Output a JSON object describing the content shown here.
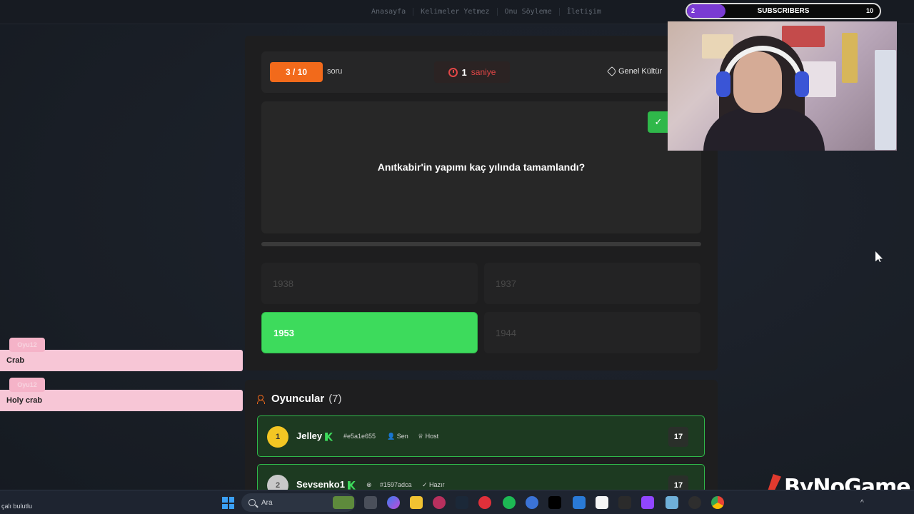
{
  "nav": {
    "links": [
      "Anasayfa",
      "Kelimeler Yetmez",
      "Onu Söyleme",
      "İletişim"
    ]
  },
  "quiz": {
    "counter": "3 / 10",
    "counter_label": "soru",
    "timer_value": "1",
    "timer_unit": "saniye",
    "category": "Genel Kültür",
    "question": "Anıtkabir'in yapımı kaç yılında tamamlandı?",
    "check_icon": "✓",
    "answers": [
      {
        "label": "1938",
        "state": "inactive"
      },
      {
        "label": "1937",
        "state": "inactive"
      },
      {
        "label": "1953",
        "state": "correct"
      },
      {
        "label": "1944",
        "state": "inactive"
      }
    ]
  },
  "players": {
    "title": "Oyuncular",
    "count": "(7)",
    "rows": [
      {
        "rank": "1",
        "name": "Jelley",
        "hash": "#e5a1e655",
        "tag1": "Sen",
        "tag2": "Host",
        "score": "17"
      },
      {
        "rank": "2",
        "name": "Sevsenko1",
        "hash": "#1597adca",
        "tag1": "Hazır",
        "tag2": "",
        "score": "17"
      }
    ]
  },
  "chat": [
    {
      "badge": "Oyu12",
      "text": "Crab"
    },
    {
      "badge": "Oyu12",
      "text": "Holy crab"
    }
  ],
  "stream": {
    "sub_current": "2",
    "sub_label": "SUBSCRIBERS",
    "sub_goal": "10",
    "sub_progress": 0.2,
    "brand": "ByNoGame"
  },
  "taskbar": {
    "weather": "çalı bulutlu",
    "search_placeholder": "Ara"
  },
  "colors": {
    "accent": "#f26a1b",
    "correct": "#3ddb5c",
    "timer": "#e04646",
    "sub_fill": "#7a3bd3"
  }
}
